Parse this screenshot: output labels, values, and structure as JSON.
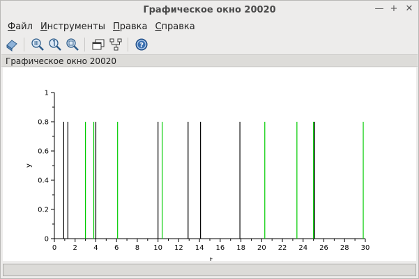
{
  "window": {
    "title": "Графическое окно 20020",
    "controls": {
      "minimize": "—",
      "maximize": "+",
      "close": "✕"
    }
  },
  "menu": [
    {
      "underline": "Ф",
      "rest": "айл"
    },
    {
      "underline": "И",
      "rest": "нструменты"
    },
    {
      "underline": "П",
      "rest": "равка"
    },
    {
      "underline": "С",
      "rest": "правка"
    }
  ],
  "toolbar": {
    "icons": [
      "rotate-icon",
      "zoom-area-icon",
      "zoom-original-icon",
      "zoom-icon",
      "windows-icon",
      "datatip-icon",
      "help-icon"
    ]
  },
  "infobar": {
    "text": "Графическое окно 20020"
  },
  "chart_data": {
    "type": "bar",
    "title": "",
    "xlabel": "t",
    "ylabel": "y",
    "xlim": [
      0,
      30
    ],
    "ylim": [
      0,
      1
    ],
    "xticks": [
      0,
      2,
      4,
      6,
      8,
      10,
      12,
      14,
      16,
      18,
      20,
      22,
      24,
      26,
      28,
      30
    ],
    "yticks": [
      0,
      0.2,
      0.4,
      0.6,
      0.8,
      1
    ],
    "yticklabels": [
      "0",
      "0.2",
      "0.4",
      "0.6",
      "0.8",
      "1"
    ],
    "series": [
      {
        "color": "#000000",
        "x": [
          0.9,
          1.3,
          4.0,
          10.0,
          12.9,
          14.1,
          17.9,
          25.1
        ],
        "y": [
          0.8,
          0.8,
          0.8,
          0.8,
          0.8,
          0.8,
          0.8,
          0.8
        ]
      },
      {
        "color": "#00cc00",
        "x": [
          3.0,
          3.8,
          6.1,
          10.4,
          20.3,
          23.4,
          25.0,
          29.8
        ],
        "y": [
          0.8,
          0.8,
          0.8,
          0.8,
          0.8,
          0.8,
          0.8,
          0.8
        ]
      }
    ]
  }
}
